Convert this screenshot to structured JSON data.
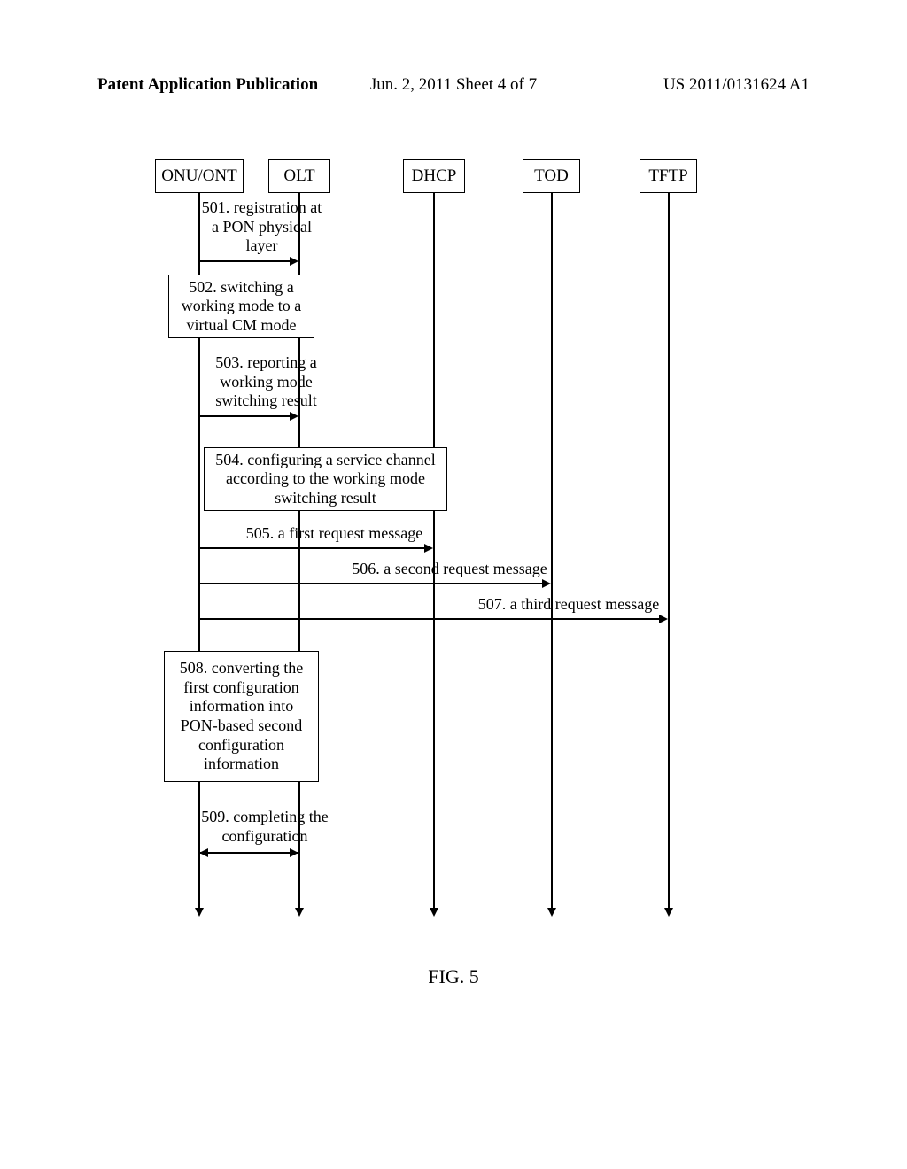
{
  "header": {
    "left": "Patent Application Publication",
    "center": "Jun. 2, 2011  Sheet 4 of 7",
    "right": "US 2011/0131624 A1"
  },
  "participants": {
    "p1": "ONU/ONT",
    "p2": "OLT",
    "p3": "DHCP",
    "p4": "TOD",
    "p5": "TFTP"
  },
  "messages": {
    "m501": "501. registration at a PON physical layer",
    "m502": "502. switching a working mode to a virtual CM mode",
    "m503": "503. reporting a working mode switching result",
    "m504": "504. configuring a service channel according to the working mode switching result",
    "m505": "505.  a first request message",
    "m506": "506. a second request message",
    "m507": "507. a third request message",
    "m508": "508. converting the first configuration information into PON-based second configuration information",
    "m509": "509. completing the configuration"
  },
  "figure_label": "FIG. 5"
}
